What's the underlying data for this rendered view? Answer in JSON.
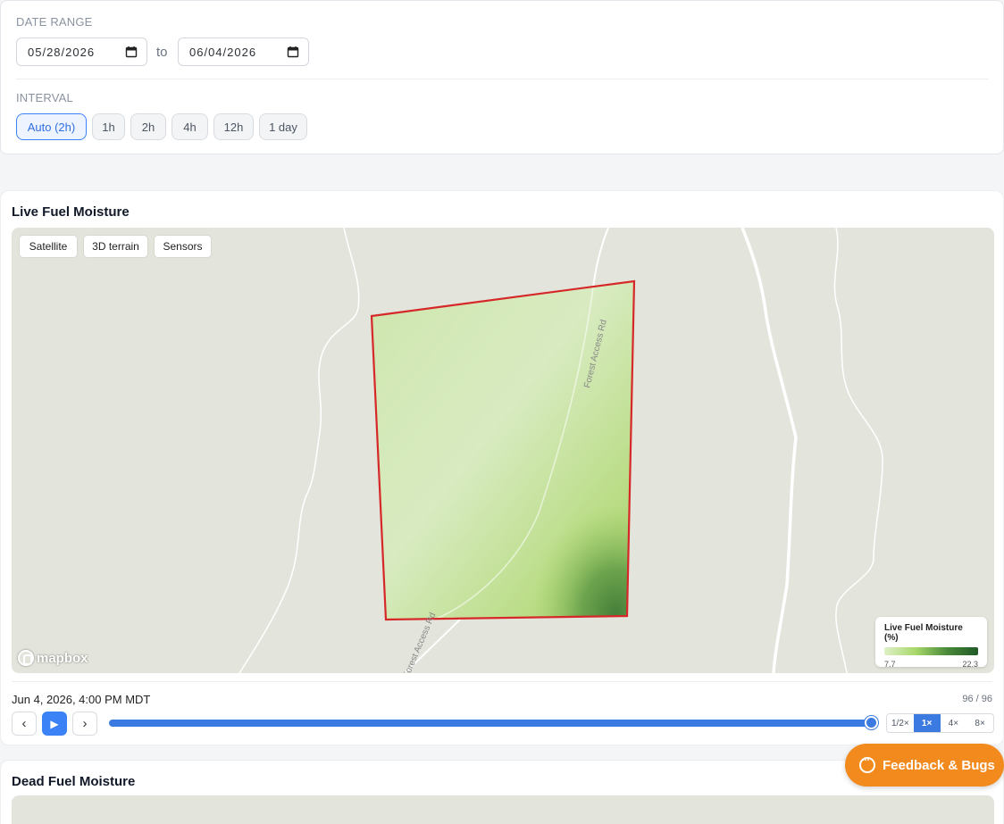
{
  "filters": {
    "date_range_label": "DATE RANGE",
    "start_date": "05/28/2026",
    "to_label": "to",
    "end_date": "06/04/2026",
    "interval_label": "INTERVAL",
    "intervals": [
      "Auto (2h)",
      "1h",
      "2h",
      "4h",
      "12h",
      "1 day"
    ],
    "selected_interval": "Auto (2h)"
  },
  "live_card": {
    "title": "Live Fuel Moisture",
    "map_buttons": [
      "Satellite",
      "3D terrain",
      "Sensors"
    ],
    "road_label": "Forest Access Rd",
    "attribution": "mapbox",
    "legend": {
      "title": "Live Fuel Moisture (%)",
      "min": "7.7",
      "max": "22.3"
    },
    "timestamp": "Jun 4, 2026, 4:00 PM MDT",
    "frame_counter": "96 / 96",
    "playback": {
      "prev": "‹",
      "play": "▶",
      "next": "›",
      "progress": 1.0
    },
    "speeds": [
      "1/2×",
      "1×",
      "4×",
      "8×"
    ],
    "selected_speed": "1×"
  },
  "dead_card": {
    "title": "Dead Fuel Moisture"
  },
  "feedback": {
    "label": "Feedback & Bugs"
  },
  "colors": {
    "accent": "#3b82f6",
    "boundary": "#dc2626",
    "feedback": "#f28a1e"
  }
}
